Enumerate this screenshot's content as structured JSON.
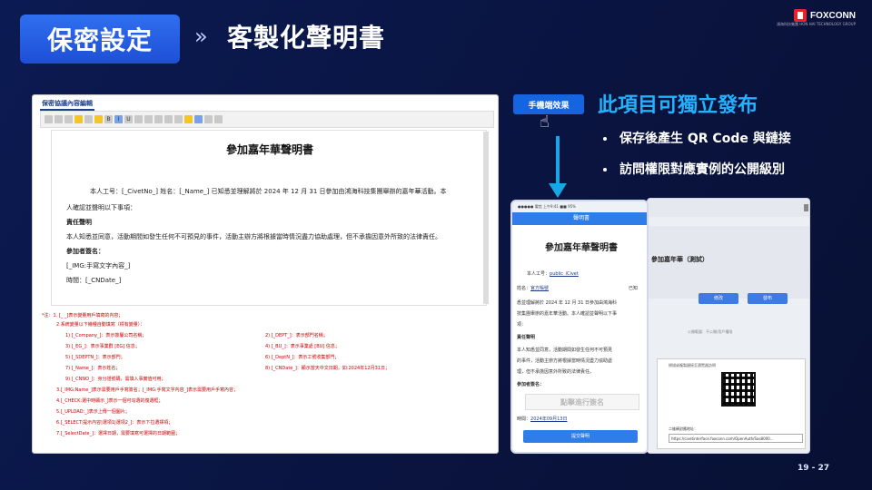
{
  "header": {
    "title": "保密設定",
    "subtitle": "客製化聲明書",
    "chevron": "»"
  },
  "logo": {
    "brand": "FOXCONN",
    "tag": "鴻海科技集團 HON HAI TECHNOLOGY GROUP",
    "accent": "#e3242b"
  },
  "editor": {
    "tab": "保密協議內容編輯",
    "doc_title": "參加嘉年華聲明書",
    "line1": "本人工号：[_CivetNo_] 姓名：[_Name_] 已知悉並理解將於 2024 年 12 月 31 日參加由鴻海科技集團舉辦的嘉年華活動。本",
    "line2": "人確認並聲明以下事項：",
    "sec1_head": "責任聲明",
    "sec1_body": "本人知悉並同意，活動期間如發生任何不可預見的事件，活動主辦方將根據當時情況盡力協助處理，但不承擔因意外所致的法律責任。",
    "sec2_head": "參加者簽名：",
    "sig": "[_IMG:手寫文字內容_]",
    "date": "時間：[_CNDate_]",
    "notes": [
      "*注：1. [_ _]表示變量用戶填寫的內容；",
      "2.系統變量以下幾種自動填寫（標有變量）：",
      "1) [_Company_]：表示簽屬公司名稱；",
      "2) [_DEPT_]：表示部門名稱；",
      "3) [_EG_]：表示事業群 [EG] 信息；",
      "4) [_BU_]：表示事業處 [BU] 信息；",
      "5) [_SDEPTN_]：表示部門；",
      "6) [_DeptN_]：表示工號收集部門；",
      "7) [_Name_]：表示姓名；",
      "8) [_CNDate_]：顯示當天中文日期，如:2024年12月31日；",
      "9) [_CNNO_]：身分證號碼，需填入事實值可用；",
      "3.[_IMG:Name_]表示需要用戶手寫簽名；[_IMG:手寫文字內容_]表示需要用戶手寫內容；",
      "4.[_CHECK:選中時顯示_]表示一個可勾選的復選框；",
      "5.[_UPLOAD:_]表示上傳一個圖片；",
      "6.[_SELECT:提示內容|選項1|選項2_]：表示下拉選擇項；",
      "7.[_SelectDate_]：選擇日期，需要填寫可選擇的日期範圍；"
    ]
  },
  "mobile_badge": "手機端效果",
  "feature": {
    "title": "此項目可獨立發布",
    "bullets": [
      "保存後產生 QR Code 與鏈接",
      "訪問權限對應實例的公開級別"
    ]
  },
  "phone": {
    "status": "●●●●● 電信 上午9:41 ■■ 95%",
    "app_title": "聲明書",
    "doc_title": "參加嘉年華聲明書",
    "id_label": "本人工号：",
    "id_value": "public_iCivet",
    "name_label": "姓名：",
    "name_value": "官方賬號",
    "known": "已知",
    "body1": "悉並理解將於 2024 年 12 月 31 日參加由鴻海科",
    "body2": "技集團舉辦的嘉年華活動。本人確認並聲明以下事",
    "body3": "項：",
    "sec1": "責任聲明",
    "b1": "本人知悉並同意，活動期間如發生任何不可預見",
    "b2": "的事件，活動主辦方將根據當時情況盡力協助處",
    "b3": "理，但不承擔因意外所致的法律責任。",
    "sign_label": "參加者簽名：",
    "sign_placeholder": "點擊進行簽名",
    "date_label": "時間：",
    "date_value": "2024年09月13日",
    "submit": "提交聲明"
  },
  "desktop": {
    "heading": "參加嘉年華（測試）",
    "btn1": "修改",
    "btn2": "發布",
    "perm": "公開範圍：不公開/用戶權限",
    "qr_title": "掃描或複製鏈接至瀏覽器訪問",
    "qr_label": "二維碼對應地址：",
    "qr_url": "https://civetinterface.foxconn.com/OpenAuth/Sas8000..."
  },
  "page": "19 - 27"
}
